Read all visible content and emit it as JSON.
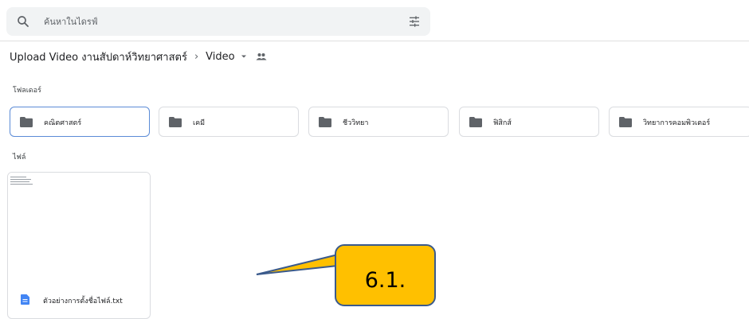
{
  "search": {
    "placeholder": "ค้นหาในไดรฟ์"
  },
  "breadcrumb": {
    "root": "Upload Video งานสัปดาห์วิทยาศาสตร์",
    "current": "Video"
  },
  "folders_section": {
    "label": "โฟลเดอร์",
    "items": [
      {
        "label": "คณิตศาสตร์"
      },
      {
        "label": "เคมี"
      },
      {
        "label": "ชีววิทยา"
      },
      {
        "label": "ฟิสิกส์"
      },
      {
        "label": "วิทยาการคอมพิวเตอร์"
      }
    ]
  },
  "files_section": {
    "label": "ไฟล์",
    "items": [
      {
        "name": "ตัวอย่างการตั้งชื่อไฟล์.txt"
      }
    ]
  },
  "callout": {
    "label": "6.1."
  },
  "colors": {
    "callout_fill": "#ffc000",
    "callout_border": "#3a5a8c",
    "doc_icon": "#4285f4",
    "folder_icon": "#5f6368"
  }
}
